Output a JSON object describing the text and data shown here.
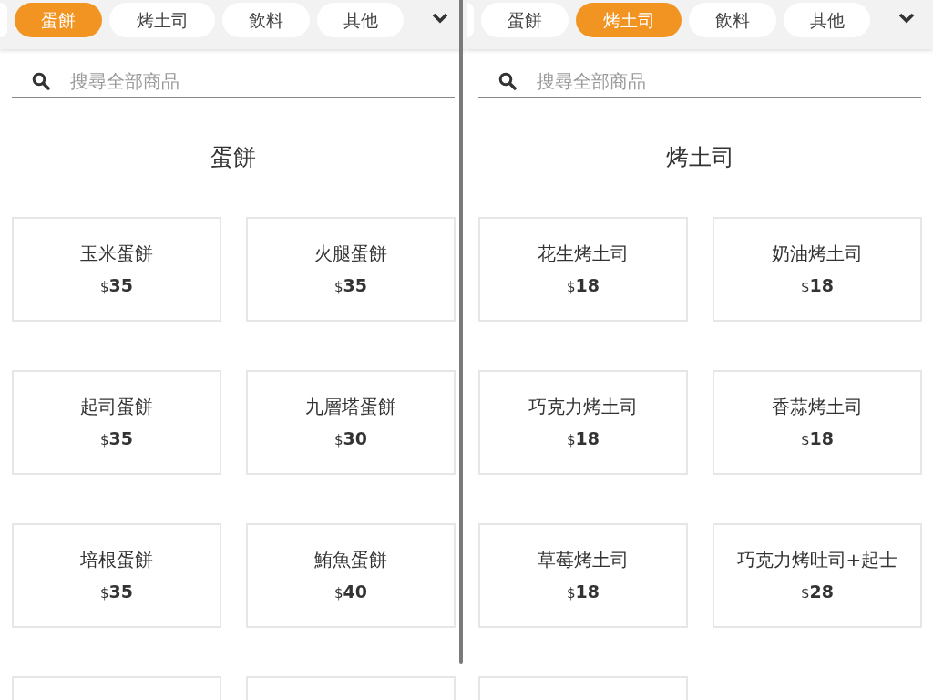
{
  "panels": [
    {
      "tabs": [
        {
          "label": "蛋餅",
          "selected": true
        },
        {
          "label": "烤土司",
          "selected": false
        },
        {
          "label": "飲料",
          "selected": false
        },
        {
          "label": "其他",
          "selected": false
        }
      ],
      "search": {
        "placeholder": "搜尋全部商品"
      },
      "heading": "蛋餅",
      "products": [
        {
          "kind": "item",
          "name": "玉米蛋餅",
          "currency": "$",
          "price": "35"
        },
        {
          "kind": "item",
          "name": "火腿蛋餅",
          "currency": "$",
          "price": "35"
        },
        {
          "kind": "item",
          "name": "起司蛋餅",
          "currency": "$",
          "price": "35"
        },
        {
          "kind": "item",
          "name": "九層塔蛋餅",
          "currency": "$",
          "price": "30"
        },
        {
          "kind": "item",
          "name": "培根蛋餅",
          "currency": "$",
          "price": "35"
        },
        {
          "kind": "item",
          "name": "鮪魚蛋餅",
          "currency": "$",
          "price": "40"
        },
        {
          "kind": "cut"
        },
        {
          "kind": "cut"
        }
      ]
    },
    {
      "tabs": [
        {
          "label": "蛋餅",
          "selected": false
        },
        {
          "label": "烤土司",
          "selected": true
        },
        {
          "label": "飲料",
          "selected": false
        },
        {
          "label": "其他",
          "selected": false
        }
      ],
      "search": {
        "placeholder": "搜尋全部商品"
      },
      "heading": "烤土司",
      "products": [
        {
          "kind": "item",
          "name": "花生烤土司",
          "currency": "$",
          "price": "18"
        },
        {
          "kind": "item",
          "name": "奶油烤土司",
          "currency": "$",
          "price": "18"
        },
        {
          "kind": "item",
          "name": "巧克力烤土司",
          "currency": "$",
          "price": "18"
        },
        {
          "kind": "item",
          "name": "香蒜烤土司",
          "currency": "$",
          "price": "18"
        },
        {
          "kind": "item",
          "name": "草莓烤土司",
          "currency": "$",
          "price": "18"
        },
        {
          "kind": "item",
          "name": "巧克力烤吐司+起士",
          "currency": "$",
          "price": "28"
        },
        {
          "kind": "cut"
        }
      ]
    }
  ]
}
